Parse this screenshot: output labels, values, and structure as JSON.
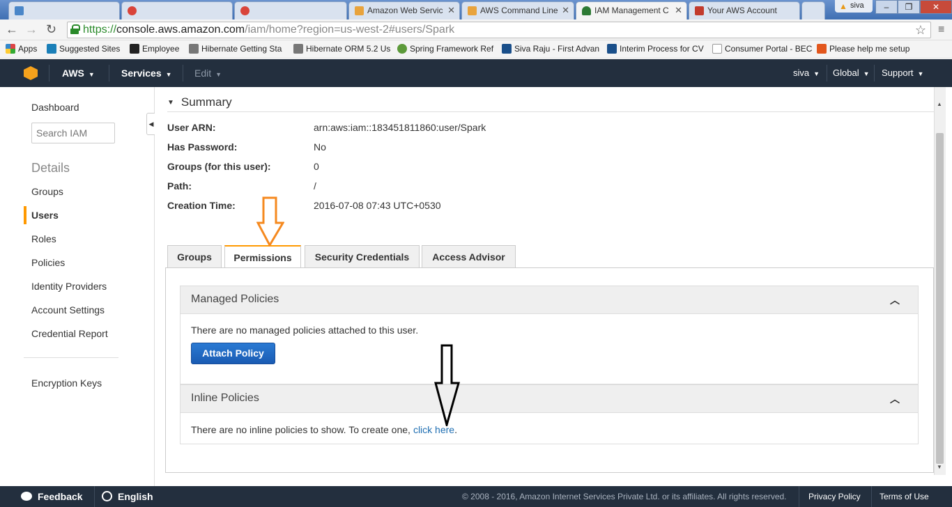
{
  "browser": {
    "tabs": [
      {
        "label": "",
        "icon_color": "#4a86c8"
      },
      {
        "label": "",
        "icon_color": "#d9443a"
      },
      {
        "label": "",
        "icon_color": "#d9443a"
      },
      {
        "label": "Amazon Web Servic",
        "icon_color": "#e8a33d"
      },
      {
        "label": "AWS Command Line",
        "icon_color": "#e8a33d"
      },
      {
        "label": "IAM Management C",
        "icon_color": "#2d7a34"
      },
      {
        "label": "Your AWS Account",
        "icon_color": "#c23b2d"
      }
    ],
    "profile_name": "siva",
    "window_controls": {
      "minimize": "–",
      "restore": "❐",
      "close": "✕"
    },
    "url_scheme": "https://",
    "url_host": "console.aws.amazon.com",
    "url_path": "/iam/home?region=us-west-2#users/Spark",
    "bookmarks": [
      {
        "label": "Apps",
        "icon_color": "#d44"
      },
      {
        "label": "Suggested Sites",
        "icon_color": "#1a7fb8"
      },
      {
        "label": "Employee",
        "icon_color": "#222"
      },
      {
        "label": "Hibernate Getting Sta",
        "icon_color": "#777"
      },
      {
        "label": "Hibernate ORM 5.2 Us",
        "icon_color": "#777"
      },
      {
        "label": "Spring Framework Ref",
        "icon_color": "#5c9a3a"
      },
      {
        "label": "Siva Raju - First Advan",
        "icon_color": "#1a4f8a"
      },
      {
        "label": "Interim Process for CV",
        "icon_color": "#1a4f8a"
      },
      {
        "label": "Consumer Portal - BEC",
        "icon_color": "#999"
      },
      {
        "label": "Please help me setup",
        "icon_color": "#e2561c"
      }
    ]
  },
  "aws_header": {
    "brand": "AWS",
    "services": "Services",
    "edit": "Edit",
    "user": "siva",
    "region": "Global",
    "support": "Support"
  },
  "sidenav": {
    "dashboard": "Dashboard",
    "search_placeholder": "Search IAM",
    "heading": "Details",
    "items": [
      "Groups",
      "Users",
      "Roles",
      "Policies",
      "Identity Providers",
      "Account Settings",
      "Credential Report"
    ],
    "active_item": "Users",
    "encryption": "Encryption Keys"
  },
  "summary": {
    "title": "Summary",
    "rows": [
      {
        "label": "User ARN:",
        "value": "arn:aws:iam::183451811860:user/Spark"
      },
      {
        "label": "Has Password:",
        "value": "No"
      },
      {
        "label": "Groups (for this user):",
        "value": "0"
      },
      {
        "label": "Path:",
        "value": "/"
      },
      {
        "label": "Creation Time:",
        "value": "2016-07-08 07:43 UTC+0530"
      }
    ]
  },
  "user_tabs": [
    "Groups",
    "Permissions",
    "Security Credentials",
    "Access Advisor"
  ],
  "active_tab": "Permissions",
  "managed_policies": {
    "title": "Managed Policies",
    "message": "There are no managed policies attached to this user.",
    "button": "Attach Policy"
  },
  "inline_policies": {
    "title": "Inline Policies",
    "message": "There are no inline policies to show. To create one,",
    "link": "click here",
    "trailing": "."
  },
  "footer": {
    "feedback": "Feedback",
    "language": "English",
    "copyright": "© 2008 - 2016, Amazon Internet Services Private Ltd. or its affiliates. All rights reserved.",
    "privacy": "Privacy Policy",
    "terms": "Terms of Use"
  },
  "colors": {
    "aws_header_bg": "#232f3e",
    "accent_orange": "#ff9900",
    "button_blue": "#1f6fc9",
    "link_blue": "#1f6fb2"
  }
}
